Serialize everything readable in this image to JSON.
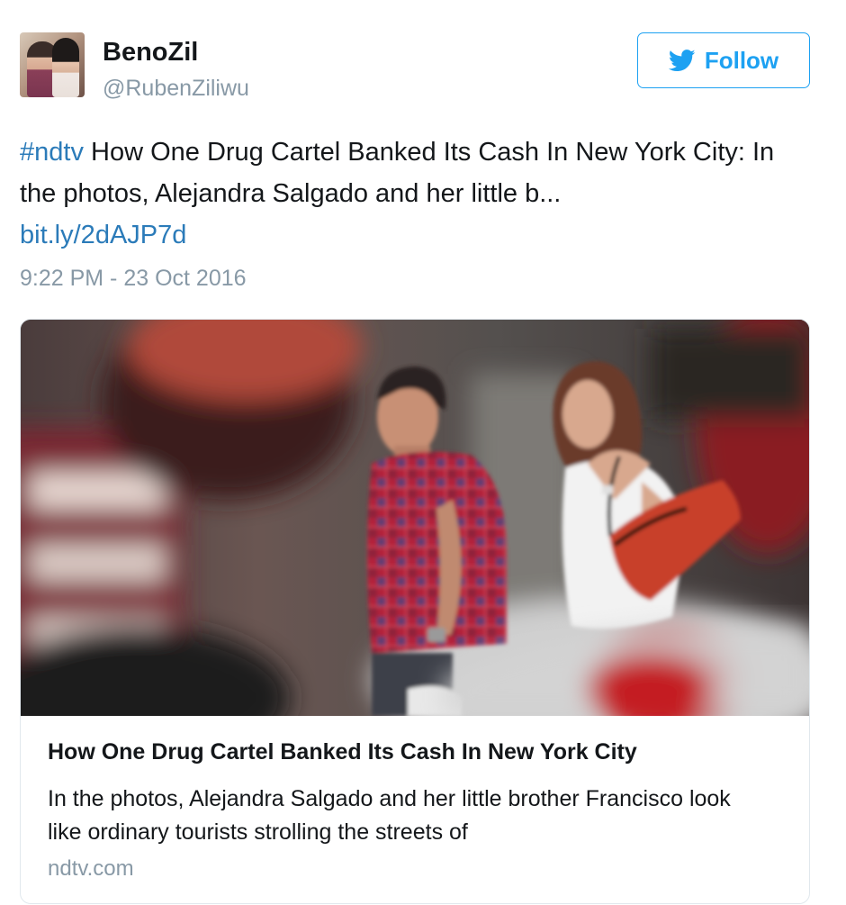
{
  "user": {
    "display_name": "BenoZil",
    "handle": "@RubenZiliwu"
  },
  "follow_button": {
    "label": "Follow",
    "icon": "twitter-bird-icon"
  },
  "tweet": {
    "hashtag": "#ndtv",
    "text": " How One Drug Cartel Banked Its Cash In New York City: In the photos, Alejandra Salgado and her little b... ",
    "link": "bit.ly/2dAJP7d",
    "timestamp": "9:22 PM - 23 Oct 2016"
  },
  "card": {
    "title": "How One Drug Cartel Banked Its Cash In New York City",
    "description": "In the photos, Alejandra Salgado and her little brother Francisco look like ordinary tourists strolling the streets of",
    "domain": "ndtv.com"
  },
  "colors": {
    "brand_blue": "#1da1f2",
    "link_blue": "#2b7bb9",
    "muted_gray": "#8899a6",
    "text": "#14171a"
  }
}
